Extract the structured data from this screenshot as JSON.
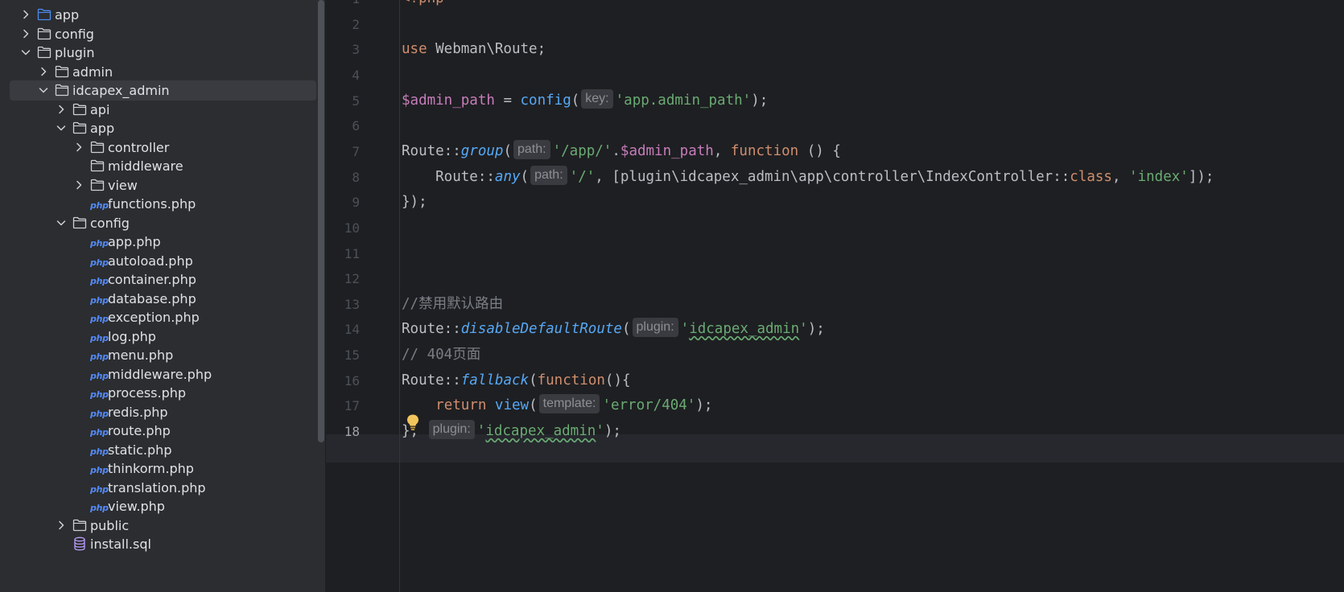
{
  "project_tree": {
    "items": [
      {
        "label": "app",
        "type": "folder",
        "state": "collapsed",
        "depth": 0,
        "icon": "folder-icon",
        "highlight_color": "#4d8cf0"
      },
      {
        "label": "config",
        "type": "folder",
        "state": "collapsed",
        "depth": 0,
        "icon": "folder-icon"
      },
      {
        "label": "plugin",
        "type": "folder",
        "state": "expanded",
        "depth": 0,
        "icon": "folder-icon"
      },
      {
        "label": "admin",
        "type": "folder",
        "state": "collapsed",
        "depth": 1,
        "icon": "folder-icon"
      },
      {
        "label": "idcapex_admin",
        "type": "folder",
        "state": "expanded",
        "depth": 1,
        "icon": "folder-icon",
        "selected": true
      },
      {
        "label": "api",
        "type": "folder",
        "state": "collapsed",
        "depth": 2,
        "icon": "folder-icon"
      },
      {
        "label": "app",
        "type": "folder",
        "state": "expanded",
        "depth": 2,
        "icon": "folder-icon"
      },
      {
        "label": "controller",
        "type": "folder",
        "state": "collapsed",
        "depth": 3,
        "icon": "folder-icon"
      },
      {
        "label": "middleware",
        "type": "folder",
        "state": "leaf",
        "depth": 3,
        "icon": "folder-icon"
      },
      {
        "label": "view",
        "type": "folder",
        "state": "collapsed",
        "depth": 3,
        "icon": "folder-icon"
      },
      {
        "label": "functions.php",
        "type": "php",
        "depth": 3,
        "icon": "php-file-icon",
        "icon_text": "php"
      },
      {
        "label": "config",
        "type": "folder",
        "state": "expanded",
        "depth": 2,
        "icon": "folder-icon"
      },
      {
        "label": "app.php",
        "type": "php",
        "depth": 3,
        "icon": "php-file-icon",
        "icon_text": "php"
      },
      {
        "label": "autoload.php",
        "type": "php",
        "depth": 3,
        "icon": "php-file-icon",
        "icon_text": "php"
      },
      {
        "label": "container.php",
        "type": "php",
        "depth": 3,
        "icon": "php-file-icon",
        "icon_text": "php"
      },
      {
        "label": "database.php",
        "type": "php",
        "depth": 3,
        "icon": "php-file-icon",
        "icon_text": "php"
      },
      {
        "label": "exception.php",
        "type": "php",
        "depth": 3,
        "icon": "php-file-icon",
        "icon_text": "php"
      },
      {
        "label": "log.php",
        "type": "php",
        "depth": 3,
        "icon": "php-file-icon",
        "icon_text": "php"
      },
      {
        "label": "menu.php",
        "type": "php",
        "depth": 3,
        "icon": "php-file-icon",
        "icon_text": "php"
      },
      {
        "label": "middleware.php",
        "type": "php",
        "depth": 3,
        "icon": "php-file-icon",
        "icon_text": "php"
      },
      {
        "label": "process.php",
        "type": "php",
        "depth": 3,
        "icon": "php-file-icon",
        "icon_text": "php"
      },
      {
        "label": "redis.php",
        "type": "php",
        "depth": 3,
        "icon": "php-file-icon",
        "icon_text": "php"
      },
      {
        "label": "route.php",
        "type": "php",
        "depth": 3,
        "icon": "php-file-icon",
        "icon_text": "php"
      },
      {
        "label": "static.php",
        "type": "php",
        "depth": 3,
        "icon": "php-file-icon",
        "icon_text": "php"
      },
      {
        "label": "thinkorm.php",
        "type": "php",
        "depth": 3,
        "icon": "php-file-icon",
        "icon_text": "php"
      },
      {
        "label": "translation.php",
        "type": "php",
        "depth": 3,
        "icon": "php-file-icon",
        "icon_text": "php"
      },
      {
        "label": "view.php",
        "type": "php",
        "depth": 3,
        "icon": "php-file-icon",
        "icon_text": "php"
      },
      {
        "label": "public",
        "type": "folder",
        "state": "collapsed",
        "depth": 2,
        "icon": "folder-icon"
      },
      {
        "label": "install.sql",
        "type": "sql",
        "depth": 2,
        "icon": "database-icon"
      }
    ]
  },
  "editor": {
    "current_line": 18,
    "lines": [
      {
        "n": "1",
        "tokens": [
          {
            "t": "<?php",
            "c": "kw"
          }
        ]
      },
      {
        "n": "2",
        "tokens": []
      },
      {
        "n": "3",
        "tokens": [
          {
            "t": "use",
            "c": "kw"
          },
          {
            "t": " Webman\\Route;",
            "c": ""
          }
        ]
      },
      {
        "n": "4",
        "tokens": []
      },
      {
        "n": "5",
        "tokens": [
          {
            "t": "$admin_path",
            "c": "var"
          },
          {
            "t": " = ",
            "c": ""
          },
          {
            "t": "config",
            "c": "fn"
          },
          {
            "t": "(",
            "c": ""
          },
          {
            "t": "key:",
            "c": "hint"
          },
          {
            "t": "'app.admin_path'",
            "c": "str"
          },
          {
            "t": ");",
            "c": ""
          }
        ]
      },
      {
        "n": "6",
        "tokens": []
      },
      {
        "n": "7",
        "tokens": [
          {
            "t": "Route::",
            "c": ""
          },
          {
            "t": "group",
            "c": "fni"
          },
          {
            "t": "(",
            "c": ""
          },
          {
            "t": "path:",
            "c": "hint"
          },
          {
            "t": "'/app/'",
            "c": "str"
          },
          {
            "t": ".",
            "c": ""
          },
          {
            "t": "$admin_path",
            "c": "var"
          },
          {
            "t": ", ",
            "c": ""
          },
          {
            "t": "function",
            "c": "kw"
          },
          {
            "t": " () {",
            "c": ""
          }
        ]
      },
      {
        "n": "8",
        "tokens": [
          {
            "t": "    Route::",
            "c": ""
          },
          {
            "t": "any",
            "c": "fni"
          },
          {
            "t": "(",
            "c": ""
          },
          {
            "t": "path:",
            "c": "hint"
          },
          {
            "t": "'/'",
            "c": "str"
          },
          {
            "t": ", [plugin\\idcapex_admin\\app\\controller\\IndexController::",
            "c": ""
          },
          {
            "t": "class",
            "c": "kw"
          },
          {
            "t": ", ",
            "c": ""
          },
          {
            "t": "'index'",
            "c": "str"
          },
          {
            "t": "]);",
            "c": ""
          }
        ]
      },
      {
        "n": "9",
        "tokens": [
          {
            "t": "});",
            "c": ""
          }
        ]
      },
      {
        "n": "10",
        "tokens": []
      },
      {
        "n": "11",
        "tokens": []
      },
      {
        "n": "12",
        "tokens": []
      },
      {
        "n": "13",
        "tokens": [
          {
            "t": "//禁用默认路由",
            "c": "cmt"
          }
        ]
      },
      {
        "n": "14",
        "tokens": [
          {
            "t": "Route::",
            "c": ""
          },
          {
            "t": "disableDefaultRoute",
            "c": "fni"
          },
          {
            "t": "(",
            "c": ""
          },
          {
            "t": "plugin:",
            "c": "hint"
          },
          {
            "t": "'",
            "c": "str"
          },
          {
            "t": "idcapex_admin",
            "c": "str sq"
          },
          {
            "t": "'",
            "c": "str"
          },
          {
            "t": ");",
            "c": ""
          }
        ]
      },
      {
        "n": "15",
        "tokens": [
          {
            "t": "// 404页面",
            "c": "cmt"
          }
        ]
      },
      {
        "n": "16",
        "tokens": [
          {
            "t": "Route::",
            "c": ""
          },
          {
            "t": "fallback",
            "c": "fni"
          },
          {
            "t": "(",
            "c": ""
          },
          {
            "t": "function",
            "c": "kw"
          },
          {
            "t": "(){",
            "c": ""
          }
        ]
      },
      {
        "n": "17",
        "tokens": [
          {
            "t": "    ",
            "c": ""
          },
          {
            "t": "return",
            "c": "kw"
          },
          {
            "t": " ",
            "c": ""
          },
          {
            "t": "view",
            "c": "fn"
          },
          {
            "t": "(",
            "c": ""
          },
          {
            "t": "template:",
            "c": "hint"
          },
          {
            "t": "'error/404'",
            "c": "str"
          },
          {
            "t": ");",
            "c": ""
          }
        ]
      },
      {
        "n": "18",
        "tokens": [
          {
            "t": "}, ",
            "c": ""
          },
          {
            "t": "plugin:",
            "c": "hint"
          },
          {
            "t": "'",
            "c": "str"
          },
          {
            "t": "idcapex_admin",
            "c": "str sq"
          },
          {
            "t": "'",
            "c": "str"
          },
          {
            "t": ");",
            "c": ""
          }
        ]
      }
    ],
    "intention_icon": "lightbulb-icon",
    "colors": {
      "keyword": "#cf8e6d",
      "variable": "#c77dbb",
      "function": "#56a8f5",
      "string": "#6aab73",
      "comment": "#7a7e85",
      "text": "#bcbec4",
      "background": "#1e1f22",
      "sidebar": "#2b2d30"
    }
  }
}
